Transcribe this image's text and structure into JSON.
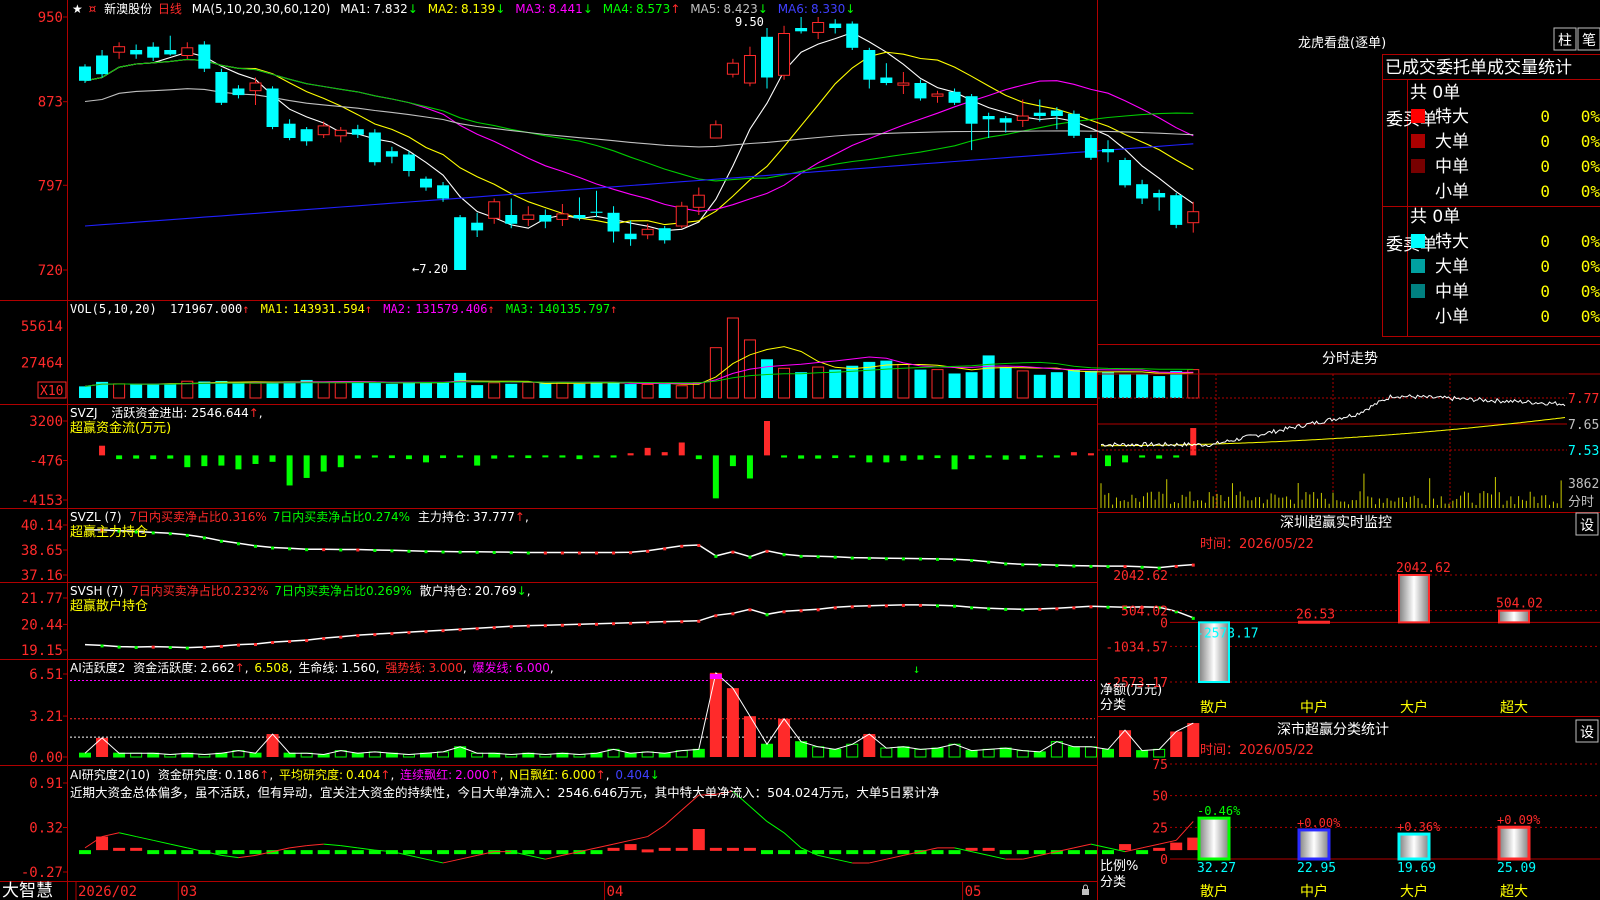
{
  "stock": {
    "star": "★",
    "name": "新澳股份",
    "period": "日线"
  },
  "colors": {
    "up": "#ff2a2a",
    "down": "#00ffff",
    "frame": "#b00000",
    "ma1": "#ffffff",
    "ma2": "#ffff00",
    "ma3": "#ff00ff",
    "ma4": "#00cc00",
    "ma5": "#c0c0c0",
    "ma6": "#2020ff"
  },
  "kline": {
    "ma_title": "MA(5,10,20,30,60,120)",
    "ma_items": [
      {
        "label": "MA1:",
        "value": "7.832",
        "arrow": "↓",
        "color": "#ffffff"
      },
      {
        "label": "MA2:",
        "value": "8.139",
        "arrow": "↓",
        "color": "#ffff00"
      },
      {
        "label": "MA3:",
        "value": "8.441",
        "arrow": "↓",
        "color": "#ff00ff"
      },
      {
        "label": "MA4:",
        "value": "8.573",
        "arrow": "↑",
        "color": "#00cc00"
      },
      {
        "label": "MA5:",
        "value": "8.423",
        "arrow": "↓",
        "color": "#c0c0c0"
      },
      {
        "label": "MA6:",
        "value": "8.330",
        "arrow": "↓",
        "color": "#2020ff"
      }
    ],
    "yticks": [
      "950",
      "873",
      "797",
      "720"
    ],
    "ytick_values": [
      9.5,
      8.73,
      7.97,
      7.2
    ],
    "high_mark": "9.50",
    "low_mark": "←7.20",
    "candles": [
      [
        9.05,
        8.92,
        9.07,
        8.9
      ],
      [
        9.15,
        8.98,
        9.2,
        8.95
      ],
      [
        9.18,
        9.23,
        9.27,
        9.12
      ],
      [
        9.2,
        9.16,
        9.25,
        9.12
      ],
      [
        9.23,
        9.13,
        9.27,
        9.1
      ],
      [
        9.2,
        9.16,
        9.33,
        9.15
      ],
      [
        9.15,
        9.22,
        9.27,
        9.12
      ],
      [
        9.25,
        9.03,
        9.28,
        9.0
      ],
      [
        9.0,
        8.72,
        9.03,
        8.7
      ],
      [
        8.85,
        8.79,
        8.88,
        8.76
      ],
      [
        8.83,
        8.9,
        8.95,
        8.7
      ],
      [
        8.85,
        8.5,
        8.87,
        8.48
      ],
      [
        8.53,
        8.4,
        8.57,
        8.38
      ],
      [
        8.48,
        8.37,
        8.5,
        8.33
      ],
      [
        8.43,
        8.51,
        8.55,
        8.4
      ],
      [
        8.42,
        8.47,
        8.5,
        8.36
      ],
      [
        8.48,
        8.43,
        8.52,
        8.4
      ],
      [
        8.45,
        8.18,
        8.48,
        8.15
      ],
      [
        8.28,
        8.23,
        8.32,
        8.17
      ],
      [
        8.25,
        8.1,
        8.28,
        8.05
      ],
      [
        8.03,
        7.95,
        8.05,
        7.92
      ],
      [
        7.97,
        7.85,
        8.0,
        7.82
      ],
      [
        7.68,
        7.2,
        7.7,
        7.2
      ],
      [
        7.63,
        7.56,
        7.72,
        7.5
      ],
      [
        7.67,
        7.82,
        7.85,
        7.62
      ],
      [
        7.7,
        7.62,
        7.85,
        7.58
      ],
      [
        7.66,
        7.7,
        7.78,
        7.6
      ],
      [
        7.7,
        7.64,
        7.75,
        7.58
      ],
      [
        7.66,
        7.71,
        7.8,
        7.6
      ],
      [
        7.7,
        7.67,
        7.86,
        7.65
      ],
      [
        7.73,
        7.72,
        7.92,
        7.68
      ],
      [
        7.72,
        7.55,
        7.78,
        7.45
      ],
      [
        7.53,
        7.48,
        7.65,
        7.42
      ],
      [
        7.52,
        7.57,
        7.62,
        7.48
      ],
      [
        7.58,
        7.47,
        7.6,
        7.44
      ],
      [
        7.6,
        7.78,
        7.82,
        7.58
      ],
      [
        7.77,
        7.88,
        7.95,
        7.7
      ],
      [
        8.4,
        8.52,
        8.56,
        8.4
      ],
      [
        8.98,
        9.08,
        9.12,
        8.95
      ],
      [
        8.9,
        9.15,
        9.23,
        8.87
      ],
      [
        9.32,
        8.95,
        9.4,
        8.85
      ],
      [
        8.97,
        9.35,
        9.42,
        8.93
      ],
      [
        9.4,
        9.37,
        9.5,
        9.35
      ],
      [
        9.36,
        9.45,
        9.5,
        9.3
      ],
      [
        9.44,
        9.4,
        9.48,
        9.35
      ],
      [
        9.44,
        9.22,
        9.46,
        9.2
      ],
      [
        9.2,
        8.93,
        9.22,
        8.85
      ],
      [
        8.95,
        8.9,
        9.08,
        8.88
      ],
      [
        8.88,
        8.9,
        9.0,
        8.8
      ],
      [
        8.9,
        8.76,
        8.93,
        8.74
      ],
      [
        8.78,
        8.8,
        8.83,
        8.72
      ],
      [
        8.82,
        8.72,
        8.85,
        8.7
      ],
      [
        8.78,
        8.53,
        8.8,
        8.29
      ],
      [
        8.6,
        8.57,
        8.63,
        8.4
      ],
      [
        8.58,
        8.54,
        8.6,
        8.45
      ],
      [
        8.56,
        8.6,
        8.75,
        8.5
      ],
      [
        8.63,
        8.6,
        8.75,
        8.55
      ],
      [
        8.65,
        8.6,
        8.68,
        8.48
      ],
      [
        8.62,
        8.42,
        8.65,
        8.4
      ],
      [
        8.4,
        8.22,
        8.43,
        8.2
      ],
      [
        8.3,
        8.27,
        8.38,
        8.18
      ],
      [
        8.2,
        7.97,
        8.22,
        7.95
      ],
      [
        7.98,
        7.85,
        8.02,
        7.8
      ],
      [
        7.9,
        7.86,
        7.93,
        7.74
      ],
      [
        7.88,
        7.61,
        7.9,
        7.58
      ],
      [
        7.63,
        7.73,
        7.82,
        7.54
      ]
    ]
  },
  "vol": {
    "title": "VOL(5,10,20)",
    "value": "171967.000",
    "items": [
      {
        "label": "MA1:",
        "value": "143931.594",
        "arrow": "↑",
        "color": "#ffff00"
      },
      {
        "label": "MA2:",
        "value": "131579.406",
        "arrow": "↑",
        "color": "#ff00ff"
      },
      {
        "label": "MA3:",
        "value": "140135.797",
        "arrow": "↑",
        "color": "#00cc00"
      }
    ],
    "yticks": [
      "55614",
      "27464",
      "X10"
    ],
    "ytick_values": [
      55614,
      27464,
      0
    ],
    "bars": [
      9000,
      12500,
      11000,
      10500,
      11000,
      10800,
      13000,
      12800,
      13200,
      12000,
      11500,
      12200,
      12800,
      14000,
      12000,
      11800,
      12500,
      12000,
      11000,
      12000,
      11500,
      12300,
      19500,
      10000,
      11800,
      11000,
      12000,
      11300,
      11800,
      11000,
      12500,
      12200,
      10800,
      10500,
      10800,
      9500,
      12000,
      39000,
      62000,
      45000,
      30000,
      23000,
      20000,
      24000,
      22000,
      25000,
      28000,
      29000,
      26000,
      22000,
      22000,
      19000,
      20000,
      33000,
      24000,
      21000,
      18000,
      20000,
      22000,
      21000,
      20000,
      19000,
      19000,
      17000,
      21000,
      22000
    ]
  },
  "svzj": {
    "title": "SVZJ",
    "label": "活跃资金进出:",
    "value": "2546.644",
    "arrow": "↑",
    "sub": "超赢资金流(万元)",
    "yticks": [
      "3200",
      "-476",
      "-4153"
    ],
    "ytick_values": [
      3200,
      -476,
      -4153
    ],
    "bars": [
      0,
      900,
      -350,
      -300,
      -350,
      -300,
      -1100,
      -1000,
      -950,
      -1300,
      -800,
      -600,
      -2800,
      -2100,
      -1500,
      -1100,
      -300,
      -200,
      -250,
      -350,
      -650,
      -250,
      -200,
      -950,
      -300,
      -150,
      -250,
      -150,
      -200,
      -350,
      -200,
      -200,
      200,
      700,
      300,
      1200,
      -350,
      -4000,
      -1000,
      -2150,
      3200,
      -200,
      -300,
      -300,
      -250,
      -200,
      -650,
      -650,
      -500,
      -400,
      -250,
      -1300,
      -350,
      -200,
      -400,
      -350,
      -150,
      -200,
      300,
      200,
      -1000,
      -650,
      -200,
      -300,
      -200,
      2546
    ]
  },
  "svzl": {
    "title": "SVZL (7)",
    "a_label": "7日内买卖净占比",
    "a_value": "0.316%",
    "b_label": "7日内买卖净占比",
    "b_value": "0.274%",
    "c_label": "主力持仓:",
    "c_value": "37.777",
    "arrow": "↑",
    "sub": "超赢主力持仓",
    "yticks": [
      "40.14",
      "38.65",
      "37.16"
    ],
    "ytick_values": [
      40.14,
      38.65,
      37.16
    ],
    "line": [
      39.85,
      39.85,
      39.8,
      39.75,
      39.7,
      39.65,
      39.55,
      39.4,
      39.2,
      39.05,
      38.9,
      38.8,
      38.75,
      38.7,
      38.7,
      38.68,
      38.68,
      38.65,
      38.63,
      38.6,
      38.58,
      38.56,
      38.55,
      38.54,
      38.53,
      38.52,
      38.5,
      38.5,
      38.5,
      38.5,
      38.5,
      38.5,
      38.52,
      38.6,
      38.75,
      38.9,
      38.95,
      38.3,
      38.55,
      38.25,
      38.6,
      38.4,
      38.3,
      38.28,
      38.25,
      38.2,
      38.18,
      38.16,
      38.15,
      38.14,
      38.12,
      38.1,
      38.05,
      37.95,
      37.85,
      37.8,
      37.78,
      37.75,
      37.72,
      37.7,
      37.69,
      37.69,
      37.65,
      37.6,
      37.7,
      37.78
    ]
  },
  "svsh": {
    "title": "SVSH (7)",
    "a_label": "7日内买卖净占比",
    "a_value": "0.232%",
    "b_label": "7日内买卖净占比",
    "b_value": "0.269%",
    "c_label": "散户持仓:",
    "c_value": "20.769",
    "arrow": "↓",
    "sub": "超赢散户持仓",
    "yticks": [
      "21.77",
      "20.44",
      "19.15"
    ],
    "ytick_values": [
      21.77,
      20.44,
      19.15
    ],
    "line": [
      19.42,
      19.38,
      19.32,
      19.3,
      19.32,
      19.3,
      19.27,
      19.3,
      19.35,
      19.42,
      19.45,
      19.55,
      19.6,
      19.65,
      19.75,
      19.82,
      19.9,
      19.95,
      20.0,
      20.05,
      20.1,
      20.15,
      20.2,
      20.25,
      20.3,
      20.35,
      20.38,
      20.4,
      20.42,
      20.45,
      20.47,
      20.5,
      20.52,
      20.55,
      20.58,
      20.6,
      20.62,
      20.9,
      21.0,
      21.2,
      20.95,
      21.1,
      21.15,
      21.2,
      21.3,
      21.35,
      21.38,
      21.4,
      21.42,
      21.42,
      21.4,
      21.38,
      21.3,
      21.25,
      21.22,
      21.2,
      21.22,
      21.25,
      21.3,
      21.35,
      21.33,
      21.3,
      21.32,
      21.3,
      21.1,
      20.77
    ]
  },
  "ai1": {
    "title": "AI活跃度2",
    "a_label": "资金活跃度:",
    "a_value": "2.662",
    "b_value": "6.508",
    "c_label": "生命线:",
    "c_value": "1.560",
    "d_label": "强势线:",
    "d_value": "3.000",
    "e_label": "爆发线:",
    "e_value": "6.000",
    "yticks": [
      "6.51",
      "3.21",
      "0.00"
    ],
    "ytick_values": [
      6.51,
      3.21,
      0
    ],
    "bars": [
      0.3,
      1.5,
      0.3,
      0.3,
      0.3,
      0.2,
      0.3,
      0.2,
      0.3,
      0.5,
      0.3,
      1.8,
      0.3,
      0.3,
      0.2,
      0.5,
      0.3,
      0.4,
      0.3,
      0.2,
      0.3,
      0.4,
      0.8,
      0.3,
      0.3,
      0.2,
      0.3,
      0.2,
      0.3,
      0.2,
      0.3,
      0.6,
      0.3,
      0.4,
      0.3,
      0.5,
      0.6,
      6.6,
      5.4,
      3.2,
      1.0,
      3.0,
      1.2,
      0.8,
      0.6,
      1.0,
      1.8,
      0.7,
      0.8,
      0.6,
      0.7,
      1.0,
      0.5,
      0.6,
      0.7,
      0.5,
      0.4,
      1.2,
      0.8,
      0.8,
      0.6,
      2.1,
      0.5,
      0.6,
      2.0,
      2.662
    ]
  },
  "ai2": {
    "title": "AI研究度2(10)",
    "a_label": "资金研究度:",
    "a_value": "0.186",
    "b_label": "平均研究度:",
    "b_value": "0.404",
    "c_label": "连续飘红:",
    "c_value": "2.000",
    "d_label": "N日飘红:",
    "d_value": "6.000",
    "e_value": "0.404",
    "comment": "近期大资金总体偏多，虽不活跃，但有异动，宜关注大资金的持续性，今日大单净流入：2546.646万元，其中特大单净流入：504.024万元，大单5日累计净",
    "yticks": [
      "0.91",
      "0.32",
      "-0.27"
    ],
    "ytick_values": [
      0.91,
      0.32,
      -0.27
    ],
    "bars": [
      -0.1,
      0.2,
      0.05,
      0.05,
      -0.05,
      -0.05,
      -0.05,
      -0.05,
      -0.05,
      -0.05,
      -0.05,
      -0.05,
      -0.05,
      -0.05,
      -0.05,
      -0.05,
      -0.05,
      -0.05,
      -0.05,
      -0.05,
      -0.05,
      -0.05,
      -0.05,
      -0.05,
      -0.05,
      -0.05,
      -0.05,
      -0.05,
      -0.05,
      -0.05,
      -0.05,
      0.05,
      0.1,
      0.03,
      0.05,
      0.05,
      0.3,
      0.05,
      0.05,
      0.05,
      -0.05,
      -0.05,
      -0.05,
      -0.05,
      -0.05,
      -0.05,
      -0.05,
      -0.05,
      -0.05,
      -0.05,
      -0.05,
      -0.05,
      0.05,
      0.05,
      -0.05,
      -0.05,
      -0.05,
      -0.05,
      -0.05,
      -0.05,
      -0.05,
      0.1,
      -0.05,
      0.05,
      0.12,
      0.186
    ],
    "line": [
      0.05,
      0.2,
      0.25,
      0.2,
      0.15,
      0.1,
      0.05,
      0.0,
      -0.05,
      -0.08,
      -0.05,
      0.0,
      0.05,
      0.08,
      0.1,
      0.08,
      0.05,
      0.02,
      0.0,
      -0.05,
      -0.1,
      -0.15,
      -0.1,
      -0.05,
      0.0,
      0.0,
      -0.05,
      -0.1,
      -0.05,
      0.0,
      0.05,
      0.1,
      0.15,
      0.2,
      0.35,
      0.55,
      0.75,
      0.76,
      0.8,
      0.6,
      0.4,
      0.25,
      0.05,
      -0.05,
      -0.1,
      -0.15,
      -0.15,
      -0.1,
      -0.05,
      0.0,
      0.05,
      0.05,
      0.0,
      -0.05,
      -0.1,
      -0.1,
      -0.05,
      0.0,
      0.05,
      0.1,
      0.05,
      0.0,
      0.05,
      0.1,
      0.15,
      0.4
    ]
  },
  "xaxis": {
    "labels": [
      "2026/02",
      "03",
      "04",
      "05"
    ],
    "indices": [
      0,
      6,
      31,
      52
    ]
  },
  "bottom_logo": "大智慧",
  "dragon": {
    "title": "龙虎看盘(逐单)",
    "btn1": "柱",
    "btn2": "笔",
    "table_title": "已成交委托单成交量统计",
    "buy": {
      "side_label": "委买单",
      "total": "共 0单",
      "rows": [
        {
          "label": "特大",
          "value": "0",
          "pct": "0%",
          "color": "#ff0000"
        },
        {
          "label": "大单",
          "value": "0",
          "pct": "0%",
          "color": "#aa0000"
        },
        {
          "label": "中单",
          "value": "0",
          "pct": "0%",
          "color": "#770000"
        },
        {
          "label": "小单",
          "value": "0",
          "pct": "0%",
          "color": ""
        }
      ]
    },
    "sell": {
      "side_label": "委卖单",
      "total": "共 0单",
      "rows": [
        {
          "label": "特大",
          "value": "0",
          "pct": "0%",
          "color": "#00ffff"
        },
        {
          "label": "大单",
          "value": "0",
          "pct": "0%",
          "color": "#00a0a0"
        },
        {
          "label": "中单",
          "value": "0",
          "pct": "0%",
          "color": "#008080"
        },
        {
          "label": "小单",
          "value": "0",
          "pct": "0%",
          "color": ""
        }
      ]
    }
  },
  "intraday": {
    "title": "分时走势",
    "yticks": [
      "7.77",
      "7.65",
      "7.53"
    ],
    "ytick_values": [
      7.77,
      7.65,
      7.53
    ],
    "vol_tick": "3862",
    "vol_unit": "分时"
  },
  "monitor": {
    "title": "深圳超赢实时监控",
    "set_btn": "设",
    "time_label": "时间：2026/05/22",
    "yticks": [
      "2042.62",
      "504.02",
      "0",
      "-1034.57",
      "-2573.17"
    ],
    "ytick_values": [
      2042.62,
      504.02,
      0,
      -1034.57,
      -2573.17
    ],
    "axis_label": "净额(万元)",
    "axis_sub": "分类",
    "categories": [
      {
        "name": "散户",
        "value": -2573.17,
        "value_label": "-2573.17",
        "color": "#00ffff"
      },
      {
        "name": "中户",
        "value": 26.53,
        "value_label": "26.53",
        "color": "#ff2a2a"
      },
      {
        "name": "大户",
        "value": 2042.62,
        "value_label": "2042.62",
        "color": "#ff2a2a"
      },
      {
        "name": "超大",
        "value": 504.02,
        "value_label": "504.02",
        "color": "#ff2a2a"
      }
    ]
  },
  "classify": {
    "title": "深市超赢分类统计",
    "set_btn": "设",
    "time_label": "时间：2026/05/22",
    "yticks": [
      "75",
      "50",
      "25",
      "0"
    ],
    "ytick_values": [
      75,
      50,
      25,
      0
    ],
    "axis_label": "比例%",
    "axis_sub": "分类",
    "categories": [
      {
        "name": "散户",
        "value": 32.27,
        "value_label": "32.27",
        "change": "-0.46%",
        "change_color": "#00ff00",
        "color": "#00ff00"
      },
      {
        "name": "中户",
        "value": 22.95,
        "value_label": "22.95",
        "change": "+0.00%",
        "change_color": "#ff2a2a",
        "color": "#2a2aff"
      },
      {
        "name": "大户",
        "value": 19.69,
        "value_label": "19.69",
        "change": "+0.36%",
        "change_color": "#ff2a2a",
        "color": "#00ffff"
      },
      {
        "name": "超大",
        "value": 25.09,
        "value_label": "25.09",
        "change": "+0.09%",
        "change_color": "#ff2a2a",
        "color": "#ff2a2a"
      }
    ]
  }
}
